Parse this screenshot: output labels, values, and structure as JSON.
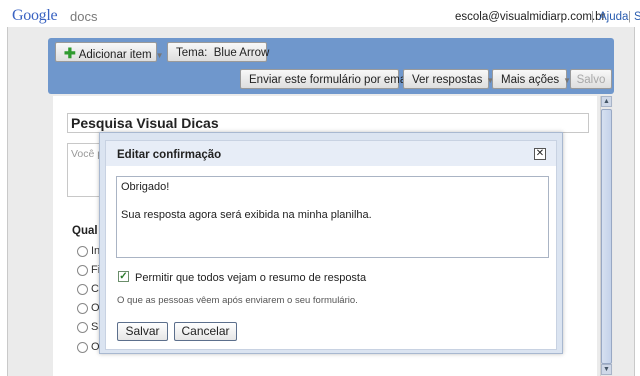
{
  "header": {
    "logo_google": "Google",
    "logo_docs": "docs",
    "account_email": "escola@visualmidiarp.com.br",
    "separator": "|",
    "help_link": "Ajuda",
    "trailing_separator": "|",
    "trailing_link_fragment": "S"
  },
  "toolbar": {
    "add_item_label": "Adicionar item",
    "theme_label": "Tema:",
    "theme_value": "Blue Arrow",
    "send_email_label": "Enviar este formulário por email",
    "view_responses_label": "Ver respostas",
    "more_actions_label": "Mais ações",
    "save_label": "Salvo"
  },
  "form": {
    "title": "Pesquisa Visual Dicas",
    "description_fragment": "Você p",
    "question_fragment": "Qual o",
    "options": [
      "Int",
      "Fi",
      "Cl",
      "Op",
      "Sa",
      "Ou"
    ]
  },
  "dialog": {
    "title": "Editar confirmação",
    "close_symbol": "✕",
    "message_line1": "Obrigado!",
    "message_line2": "Sua resposta agora será exibida na minha planilha.",
    "checkbox_label": "Permitir que todos vejam o resumo de resposta",
    "checkbox_checked": true,
    "hint": "O que as pessoas vêem após enviarem o seu formulário.",
    "save_button": "Salvar",
    "cancel_button": "Cancelar"
  },
  "icons": {
    "add": "plus-icon",
    "dropdown": "chevron-down-icon",
    "close": "close-icon",
    "check": "checkmark-icon"
  },
  "colors": {
    "toolbar_panel": "#6f97cc",
    "link": "#2a5db0",
    "dialog_frame": "#dbe4f1",
    "add_icon": "#2f9a2f"
  }
}
